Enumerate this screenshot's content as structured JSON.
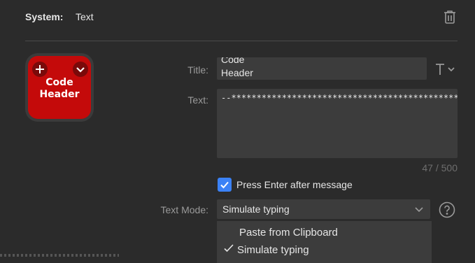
{
  "header": {
    "system_label": "System:",
    "system_value": "Text"
  },
  "icons": {
    "trash": "trash-icon",
    "plus": "plus-icon",
    "chevron": "chevron-down-icon",
    "font": "text-format-icon",
    "help": "help-icon",
    "check": "checkmark-icon"
  },
  "key": {
    "label": "Code\nHeader",
    "color": "#c40a0a"
  },
  "form": {
    "title_label": "Title:",
    "title_value": "Code\nHeader",
    "text_label": "Text:",
    "text_value": "--*********************************************",
    "counter": "47 / 500",
    "press_enter_label": "Press Enter after message",
    "press_enter_checked": true,
    "text_mode_label": "Text Mode:",
    "text_mode_value": "Simulate typing"
  },
  "dropdown": {
    "options": [
      {
        "label": "Paste from Clipboard",
        "selected": false
      },
      {
        "label": "Simulate typing",
        "selected": true
      }
    ]
  },
  "colors": {
    "background": "#2b2b2b",
    "field": "#3c3c3c",
    "accent": "#3b82f6"
  }
}
